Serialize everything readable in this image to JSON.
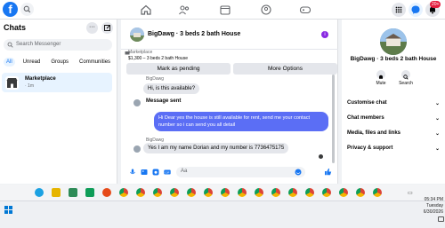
{
  "header": {
    "logo": "f",
    "notification_count": "20+"
  },
  "sidebar": {
    "title": "Chats",
    "search_placeholder": "Search Messenger",
    "filters": [
      "All",
      "Unread",
      "Groups",
      "Communities"
    ],
    "conversations": [
      {
        "name": "Marketplace",
        "time": "· 1m"
      }
    ]
  },
  "chat": {
    "title": "BigDawg · 3 beds 2 bath House",
    "marketplace_label": "Marketplace",
    "listing": "$1,300 – 3 beds 2 bath House",
    "mark_pending": "Mark as pending",
    "more_options": "More Options",
    "messages": [
      {
        "sender": "BigDawg",
        "text": "Hi, is this available?"
      },
      {
        "status": "Message sent"
      },
      {
        "text": "Hi Dear yes the house is still available for rent, send me your contact number so i can send you all detail"
      },
      {
        "sender": "BigDawg",
        "text": "Yes I am my name Dorian and my number is 7736475175"
      }
    ],
    "composer_placeholder": "Aa"
  },
  "profile": {
    "name": "BigDawg · 3 beds 2 bath House",
    "actions": [
      "Mute",
      "Search"
    ],
    "sections": [
      "Customise chat",
      "Chat members",
      "Media, files and links",
      "Privacy & support"
    ]
  },
  "taskbar": {
    "time": "05:34 PM",
    "day": "Tuesday",
    "date": "6/30/2026"
  },
  "colors": {
    "brand": "#1877f2",
    "outgoing_bubble": "#5b6ef5",
    "badge": "#e41e3f"
  }
}
